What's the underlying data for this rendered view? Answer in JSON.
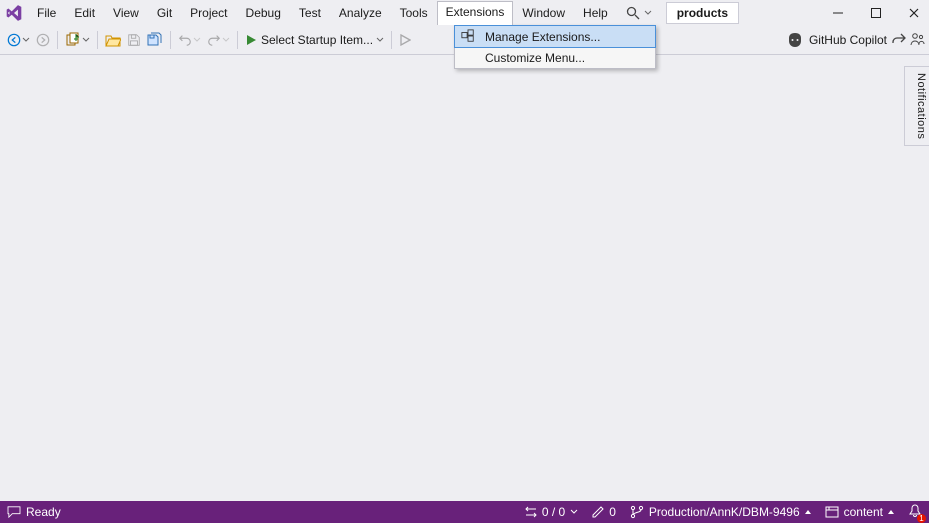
{
  "menus": {
    "file": "File",
    "edit": "Edit",
    "view": "View",
    "git": "Git",
    "project": "Project",
    "debug": "Debug",
    "test": "Test",
    "analyze": "Analyze",
    "tools": "Tools",
    "extensions": "Extensions",
    "window": "Window",
    "help": "Help"
  },
  "solution_name": "products",
  "dropdown": {
    "manage": "Manage Extensions...",
    "customize": "Customize Menu..."
  },
  "toolbar": {
    "startup": "Select Startup Item...",
    "copilot": "GitHub Copilot"
  },
  "side": {
    "notifications": "Notifications"
  },
  "status": {
    "ready": "Ready",
    "errors": "0 / 0",
    "edits": "0",
    "branch": "Production/AnnK/DBM-9496",
    "repo": "content"
  }
}
